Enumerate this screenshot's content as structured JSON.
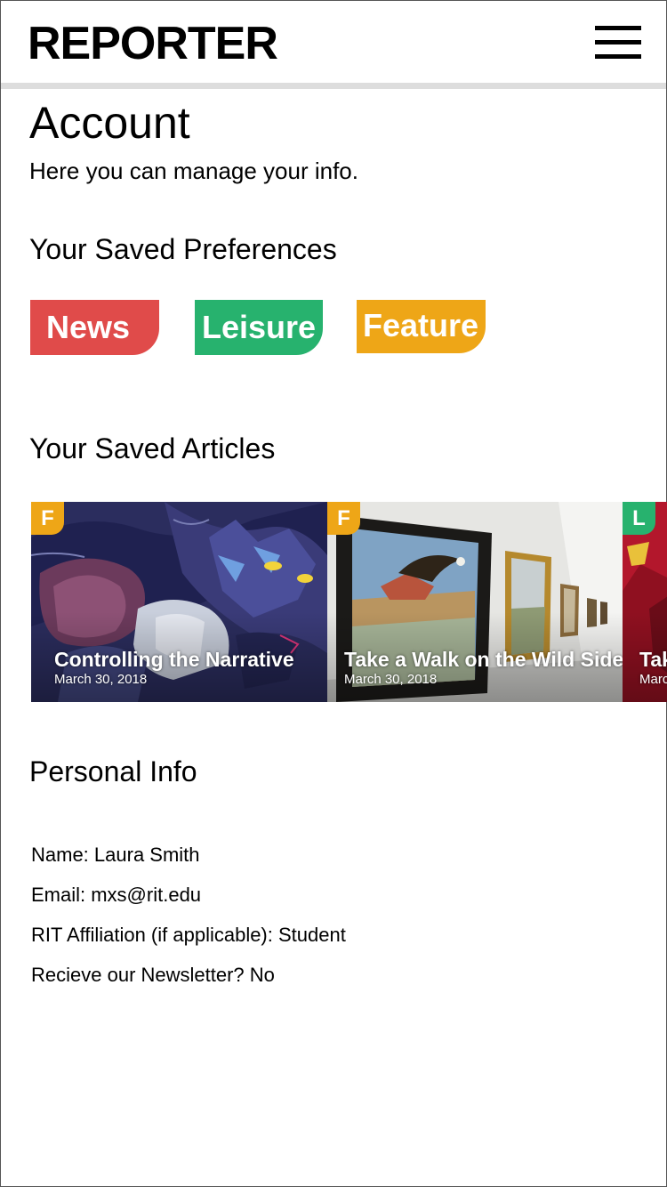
{
  "header": {
    "logo": "REPORTER",
    "menu_icon": "hamburger-menu-icon"
  },
  "page": {
    "title": "Account",
    "subtitle": "Here you can manage your info."
  },
  "preferences": {
    "heading": "Your Saved Preferences",
    "chips": [
      {
        "label": "News",
        "color": "#e04b4a"
      },
      {
        "label": "Leisure",
        "color": "#27b26e"
      },
      {
        "label": "Feature",
        "color": "#eea617"
      }
    ]
  },
  "articles": {
    "heading": "Your Saved Articles",
    "items": [
      {
        "badge": "F",
        "title": "Controlling the Narrative",
        "date": "March 30, 2018"
      },
      {
        "badge": "F",
        "title": "Take a Walk on the Wild Side",
        "date": "March 30, 2018"
      },
      {
        "badge": "L",
        "title": "Tak",
        "date": "Marc"
      }
    ]
  },
  "personal_info": {
    "heading": "Personal Info",
    "name": "Name: Laura Smith",
    "email": "Email: mxs@rit.edu",
    "affiliation": "RIT Affiliation (if applicable): Student",
    "newsletter": "Recieve our Newsletter? No"
  }
}
